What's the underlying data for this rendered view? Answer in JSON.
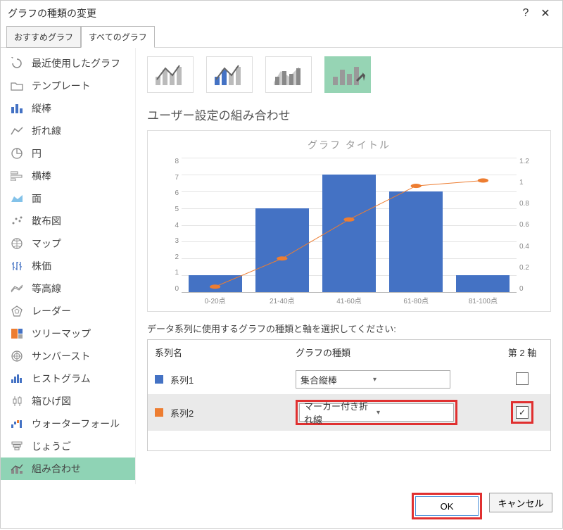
{
  "titlebar": {
    "title": "グラフの種類の変更",
    "help": "?",
    "close": "✕"
  },
  "tabs": {
    "recommended": "おすすめグラフ",
    "all": "すべてのグラフ"
  },
  "sidebar": {
    "items": [
      {
        "label": "最近使用したグラフ"
      },
      {
        "label": "テンプレート"
      },
      {
        "label": "縦棒"
      },
      {
        "label": "折れ線"
      },
      {
        "label": "円"
      },
      {
        "label": "横棒"
      },
      {
        "label": "面"
      },
      {
        "label": "散布図"
      },
      {
        "label": "マップ"
      },
      {
        "label": "株価"
      },
      {
        "label": "等高線"
      },
      {
        "label": "レーダー"
      },
      {
        "label": "ツリーマップ"
      },
      {
        "label": "サンバースト"
      },
      {
        "label": "ヒストグラム"
      },
      {
        "label": "箱ひげ図"
      },
      {
        "label": "ウォーターフォール"
      },
      {
        "label": "じょうご"
      },
      {
        "label": "組み合わせ"
      }
    ]
  },
  "main": {
    "section_title": "ユーザー設定の組み合わせ",
    "preview_title": "グラフ タイトル",
    "hint": "データ系列に使用するグラフの種類と軸を選択してください:"
  },
  "table": {
    "head": {
      "name": "系列名",
      "type": "グラフの種類",
      "axis": "第 2 軸"
    },
    "rows": [
      {
        "name": "系列1",
        "type": "集合縦棒",
        "checked": false,
        "color": "#4472c4"
      },
      {
        "name": "系列2",
        "type": "マーカー付き折れ線",
        "checked": true,
        "color": "#ed7d31"
      }
    ]
  },
  "buttons": {
    "ok": "OK",
    "cancel": "キャンセル"
  },
  "chart_data": {
    "type": "bar",
    "title": "グラフ タイトル",
    "categories": [
      "0-20点",
      "21-40点",
      "41-60点",
      "61-80点",
      "81-100点"
    ],
    "ylabel": "",
    "xlabel": "",
    "ylim": [
      0,
      8
    ],
    "y2lim": [
      0,
      1.2
    ],
    "series": [
      {
        "name": "系列1",
        "type": "bar",
        "values": [
          1,
          5,
          7,
          6,
          1
        ],
        "axis": "primary"
      },
      {
        "name": "系列2",
        "type": "line",
        "values": [
          0.05,
          0.3,
          0.65,
          0.95,
          1.0
        ],
        "axis": "secondary"
      }
    ],
    "y_ticks": [
      0,
      1,
      2,
      3,
      4,
      5,
      6,
      7,
      8
    ],
    "y2_ticks": [
      0,
      0.2,
      0.4,
      0.6,
      0.8,
      1,
      1.2
    ]
  }
}
